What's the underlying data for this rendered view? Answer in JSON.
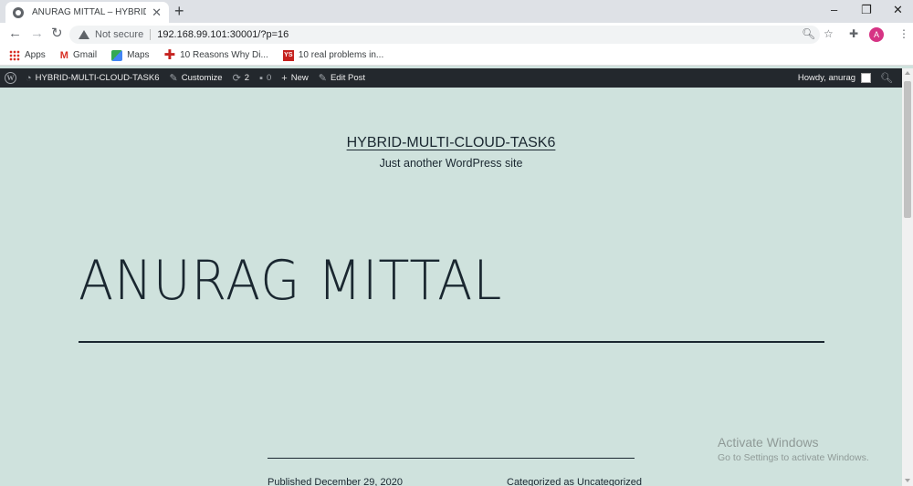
{
  "browser": {
    "tab_title": "ANURAG MITTAL – HYBRID-MUL",
    "tab_close": "✕",
    "new_tab": "+",
    "window_controls": [
      "–",
      "❐",
      "✕"
    ],
    "security_label": "Not secure",
    "url": "192.168.99.101:30001/?p=16",
    "avatar_letter": "A"
  },
  "bookmarks": [
    {
      "label": "Apps",
      "icon": "apps-icon"
    },
    {
      "label": "Gmail",
      "icon": "gmail-icon"
    },
    {
      "label": "Maps",
      "icon": "maps-icon"
    },
    {
      "label": "10 Reasons Why Di...",
      "icon": "red-cross-icon"
    },
    {
      "label": "10 real problems in...",
      "icon": "ys-icon"
    }
  ],
  "adminbar": {
    "site_name": "HYBRID-MULTI-CLOUD-TASK6",
    "customize": "Customize",
    "updates_count": "2",
    "comments_count": "0",
    "new": "New",
    "edit_post": "Edit Post",
    "howdy": "Howdy, anurag"
  },
  "site": {
    "title": "HYBRID-MULTI-CLOUD-TASK6",
    "description": "Just another WordPress site"
  },
  "post": {
    "title": "ANURAG MITTAL",
    "published": "Published December 29, 2020",
    "category": "Categorized as Uncategorized"
  },
  "watermark": {
    "line1": "Activate Windows",
    "line2": "Go to Settings to activate Windows."
  },
  "colors": {
    "page_background": "#cfe2dd",
    "adminbar": "#23282d",
    "text": "#1a2730"
  }
}
